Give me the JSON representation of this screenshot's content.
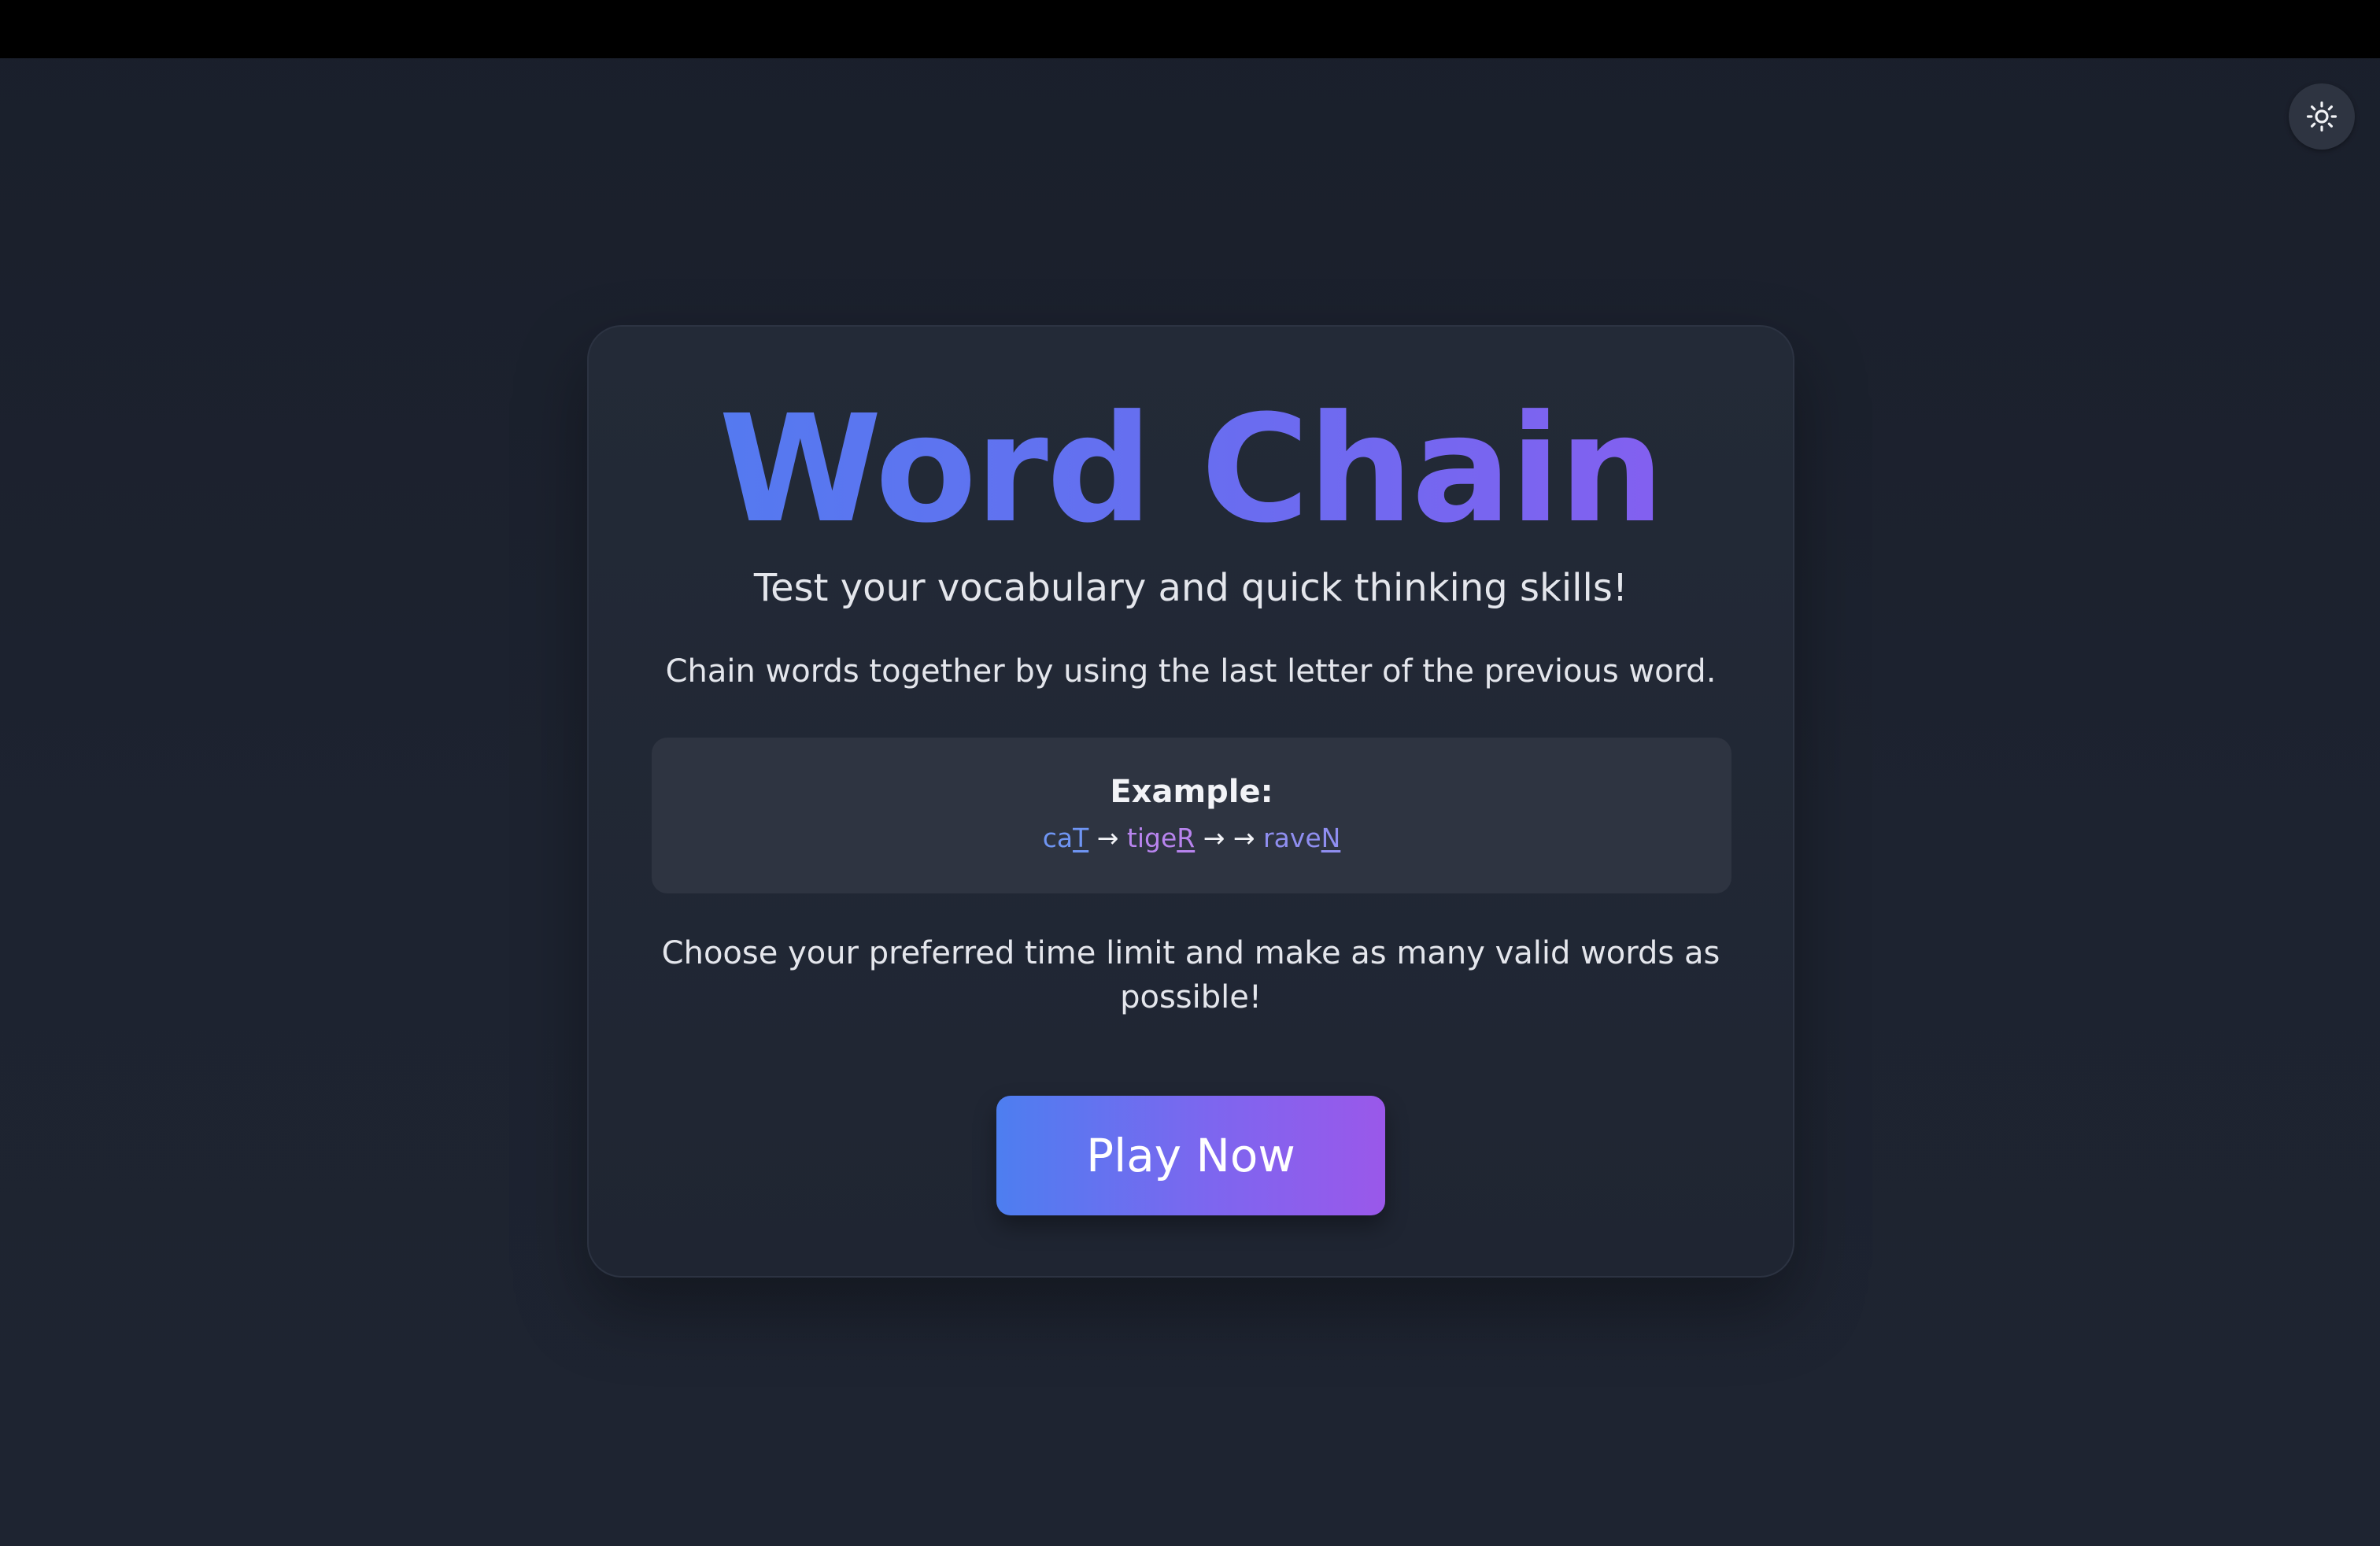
{
  "header": {
    "theme_toggle_icon": "sun-icon"
  },
  "intro": {
    "title": "Word Chain",
    "subtitle": "Test your vocabulary and quick thinking skills!",
    "description": "Chain words together by using the last letter of the previous word.",
    "example": {
      "label": "Example:",
      "words": [
        {
          "stem": "ca",
          "last": "T"
        },
        {
          "stem": "tige",
          "last": "R"
        },
        {
          "stem": "rave",
          "last": "N"
        }
      ],
      "arrow": "→"
    },
    "instructions": "Choose your preferred time limit and make as many valid words as possible!",
    "play_button_label": "Play Now"
  },
  "colors": {
    "background": "#1b2130",
    "card": "#222835",
    "example_box": "#2e3441",
    "gradient_start": "#4f7df0",
    "gradient_end": "#9a58ea",
    "word1": "#6f95f3",
    "word2": "#b884ee",
    "word3": "#8f8ef0"
  }
}
